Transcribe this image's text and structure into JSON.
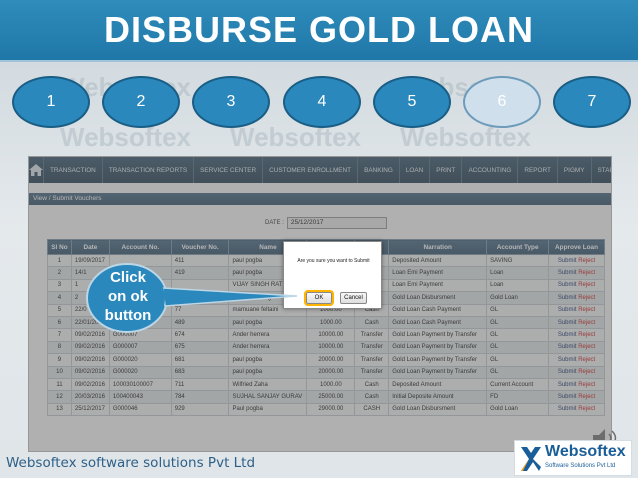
{
  "slide": {
    "title": "DISBURSE GOLD LOAN",
    "steps": [
      "1",
      "2",
      "3",
      "4",
      "5",
      "6",
      "7"
    ],
    "active_step": "6",
    "watermark": "Websoftex",
    "footer": "Websoftex software solutions Pvt Ltd",
    "logo": {
      "word": "Websoftex",
      "sub": "Software Solutions Pvt Ltd"
    },
    "callout": {
      "line1": "Click",
      "line2": "on ok",
      "line3": "button"
    }
  },
  "app": {
    "nav": [
      "TRANSACTION",
      "TRANSACTION REPORTS",
      "SERVICE CENTER",
      "CUSTOMER ENROLLMENT",
      "BANKING",
      "LOAN",
      "PRINT",
      "ACCOUNTING",
      "REPORT",
      "PIGMY",
      "STAFF ENROLLME"
    ],
    "panel_title": "View / Submit Vouchers",
    "date_label": "DATE :",
    "date_value": "25/12/2017",
    "columns": [
      "Sl No",
      "Date",
      "Account No.",
      "Voucher No.",
      "Name",
      "Amount",
      "Mode",
      "Narration",
      "Account Type",
      "Approve Loan"
    ],
    "visible_columns": [
      "Sl No",
      "Date",
      "Account No.",
      "Voucher No.",
      "Name",
      "",
      "ode",
      "Narration",
      "Account Type",
      "Approve Loan"
    ],
    "rows": [
      {
        "sl": "1",
        "date": "19/09/2017",
        "acc": "",
        "vno": "411",
        "name": "paul pogba",
        "amt": "",
        "mode": "h",
        "narr": "Deposited Amount",
        "type": "SAVING",
        "submit": "Submit",
        "reject": "Reject"
      },
      {
        "sl": "2",
        "date": "14/1",
        "acc": "",
        "vno": "419",
        "name": "paul pogba",
        "amt": "",
        "mode": "h",
        "narr": "Loan Emi Payment",
        "type": "Loan",
        "submit": "Submit",
        "reject": "Reject"
      },
      {
        "sl": "3",
        "date": "1",
        "acc": "",
        "vno": "",
        "name": "VIJAY SINGH RATHORE",
        "amt": "",
        "mode": "h",
        "narr": "Loan Emi Payment",
        "type": "Loan",
        "submit": "Submit",
        "reject": "Reject"
      },
      {
        "sl": "4",
        "date": "2",
        "acc": "",
        "vno": "",
        "name": "Usha kshatreg",
        "amt": "",
        "mode": "h",
        "narr": "Gold Loan Disbursment",
        "type": "Gold Loan",
        "submit": "Submit",
        "reject": "Reject"
      },
      {
        "sl": "5",
        "date": "22/0",
        "acc": "",
        "vno": "77",
        "name": "marnuane feltaini",
        "amt": "1000.00",
        "mode": "Cash",
        "narr": "Gold Loan Cash Payment",
        "type": "GL",
        "submit": "Submit",
        "reject": "Reject"
      },
      {
        "sl": "6",
        "date": "22/01/2015",
        "acc": "",
        "vno": "489",
        "name": "paul pogba",
        "amt": "1000.00",
        "mode": "Cash",
        "narr": "Gold Loan Cash Payment",
        "type": "GL",
        "submit": "Submit",
        "reject": "Reject"
      },
      {
        "sl": "7",
        "date": "09/02/2016",
        "acc": "G000007",
        "vno": "674",
        "name": "Ander herrera",
        "amt": "10000.00",
        "mode": "Transfer",
        "narr": "Gold Loan Payment by Transfer",
        "type": "GL",
        "submit": "Submit",
        "reject": "Reject"
      },
      {
        "sl": "8",
        "date": "09/02/2016",
        "acc": "G000007",
        "vno": "675",
        "name": "Ander herrera",
        "amt": "10000.00",
        "mode": "Transfer",
        "narr": "Gold Loan Payment by Transfer",
        "type": "GL",
        "submit": "Submit",
        "reject": "Reject"
      },
      {
        "sl": "9",
        "date": "09/02/2016",
        "acc": "G000020",
        "vno": "681",
        "name": "paul pogba",
        "amt": "20000.00",
        "mode": "Transfer",
        "narr": "Gold Loan Payment by Transfer",
        "type": "GL",
        "submit": "Submit",
        "reject": "Reject"
      },
      {
        "sl": "10",
        "date": "09/02/2016",
        "acc": "G000020",
        "vno": "683",
        "name": "paul pogba",
        "amt": "20000.00",
        "mode": "Transfer",
        "narr": "Gold Loan Payment by Transfer",
        "type": "GL",
        "submit": "Submit",
        "reject": "Reject"
      },
      {
        "sl": "11",
        "date": "09/02/2016",
        "acc": "100030100007",
        "vno": "711",
        "name": "Wilfried Zaha",
        "amt": "1000.00",
        "mode": "Cash",
        "narr": "Deposited Amount",
        "type": "Current Account",
        "submit": "Submit",
        "reject": "Reject"
      },
      {
        "sl": "12",
        "date": "20/03/2016",
        "acc": "100400043",
        "vno": "784",
        "name": "SUJHAL SANJAY GURAV",
        "amt": "25000.00",
        "mode": "Cash",
        "narr": "Initial Deposite Amount",
        "type": "FD",
        "submit": "Submit",
        "reject": "Reject"
      },
      {
        "sl": "13",
        "date": "25/12/2017",
        "acc": "G000046",
        "vno": "929",
        "name": "Paul pogba",
        "amt": "29000.00",
        "mode": "CASH",
        "narr": "Gold Loan Disbursment",
        "type": "Gold Loan",
        "submit": "Submit",
        "reject": "Reject"
      }
    ]
  },
  "modal": {
    "message": "Are you sure you want to Submit",
    "ok": "OK",
    "cancel": "Cancel"
  },
  "colors": {
    "title_bar": "#1f77a8",
    "step": "#2a88bd",
    "step_active": "#cfe0ec",
    "callout": "#2a88bd"
  }
}
